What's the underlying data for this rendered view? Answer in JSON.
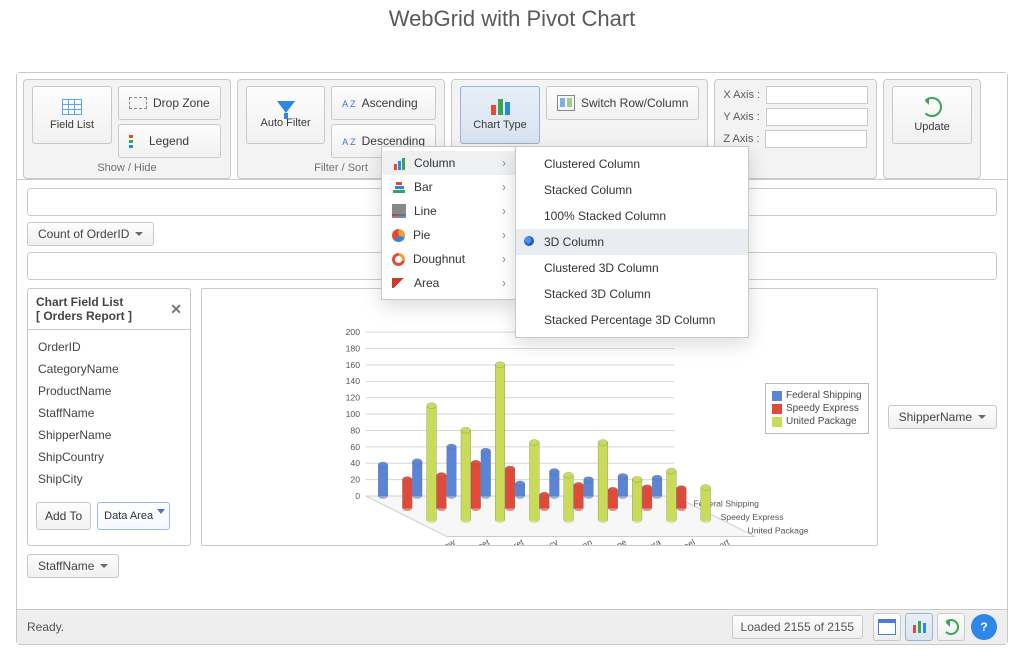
{
  "title": "WebGrid with Pivot Chart",
  "ribbon": {
    "show_hide": {
      "label": "Show / Hide",
      "field_list": "Field List",
      "drop_zone": "Drop Zone",
      "legend": "Legend"
    },
    "filter_sort": {
      "label": "Filter / Sort",
      "auto_filter": "Auto Filter",
      "ascending": "Ascending",
      "descending": "Descending"
    },
    "chart_type": "Chart Type",
    "switch_rc": "Switch Row/Column",
    "axes": {
      "x": "X Axis :",
      "y": "Y Axis :",
      "z": "Z Axis :"
    },
    "update": "Update"
  },
  "chart_menu": {
    "categories": [
      "Column",
      "Bar",
      "Line",
      "Pie",
      "Doughnut",
      "Area"
    ],
    "column_subtypes": [
      "Clustered Column",
      "Stacked Column",
      "100% Stacked Column",
      "3D Column",
      "Clustered 3D Column",
      "Stacked 3D Column",
      "Stacked Percentage 3D Column"
    ],
    "hover_category": "Column",
    "selected_subtype": "3D Column"
  },
  "measure_chip": "Count of OrderID",
  "column_chip": "ShipperName",
  "row_chip": "StaffName",
  "field_list": {
    "title1": "Chart Field List",
    "title2": "[ Orders Report ]",
    "fields": [
      "OrderID",
      "CategoryName",
      "ProductName",
      "StaffName",
      "ShipperName",
      "ShipCountry",
      "ShipCity"
    ],
    "add_to": "Add To",
    "area_select": "Data Area"
  },
  "legend": [
    "Federal Shipping",
    "Speedy Express",
    "United Package"
  ],
  "legend_colors": {
    "Federal Shipping": "#5a85d6",
    "Speedy Express": "#e04a3a",
    "United Package": "#c9db57"
  },
  "footer": {
    "status": "Ready.",
    "loaded": "Loaded 2155 of 2155"
  },
  "chart_data": {
    "type": "bar",
    "title": "",
    "xlabel": "",
    "ylabel": "",
    "ylim": [
      0,
      200
    ],
    "y_ticks": [
      0,
      20,
      40,
      60,
      80,
      100,
      120,
      140,
      160,
      180,
      200
    ],
    "categories": [
      "Andrew",
      "Janet",
      "Margaret",
      "Nancy",
      "Steven",
      "Anne",
      "Laura",
      "Michael",
      "Robert"
    ],
    "z_categories": [
      "Federal Shipping",
      "Speedy Express",
      "United Package"
    ],
    "series": [
      {
        "name": "Federal Shipping",
        "color": "#5a85d6",
        "values": [
          38,
          42,
          60,
          55,
          15,
          30,
          20,
          24,
          22
        ]
      },
      {
        "name": "Speedy Express",
        "color": "#e04a3a",
        "values": [
          35,
          40,
          55,
          48,
          16,
          28,
          22,
          25,
          24
        ]
      },
      {
        "name": "United Package",
        "color": "#c9db57",
        "values": [
          140,
          110,
          190,
          95,
          55,
          95,
          50,
          60,
          40
        ]
      }
    ]
  }
}
